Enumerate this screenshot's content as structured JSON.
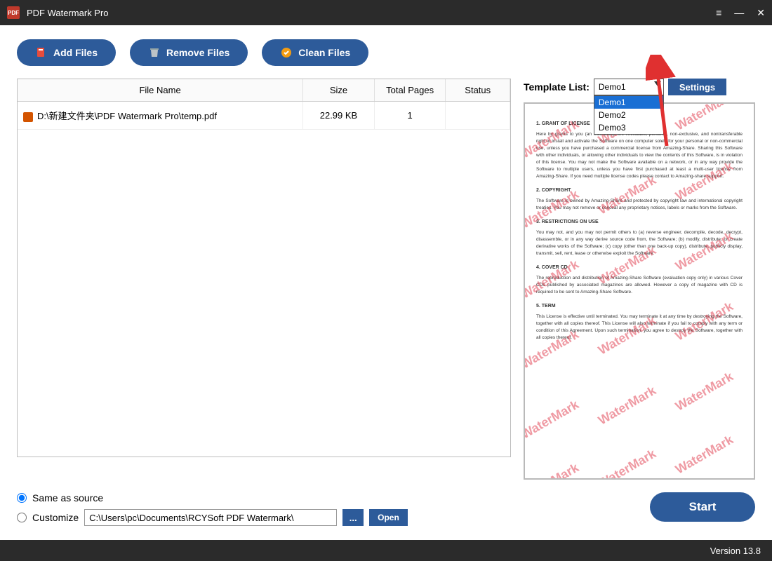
{
  "app": {
    "title": "PDF Watermark Pro"
  },
  "toolbar": {
    "add_files": "Add Files",
    "remove_files": "Remove Files",
    "clean_files": "Clean Files"
  },
  "table": {
    "columns": {
      "name": "File Name",
      "size": "Size",
      "pages": "Total Pages",
      "status": "Status"
    },
    "rows": [
      {
        "name": "D:\\新建文件夹\\PDF Watermark Pro\\temp.pdf",
        "size": "22.99 KB",
        "pages": "1",
        "status": ""
      }
    ]
  },
  "template": {
    "label": "Template List:",
    "selected": "Demo1",
    "options": [
      "Demo1",
      "Demo2",
      "Demo3"
    ],
    "settings_label": "Settings"
  },
  "output": {
    "same_as_source": "Same as source",
    "customize": "Customize",
    "path": "C:\\Users\\pc\\Documents\\RCYSoft PDF Watermark\\",
    "browse": "...",
    "open": "Open"
  },
  "start_label": "Start",
  "footer": {
    "version": "Version 13.8"
  },
  "preview": {
    "watermark_text": "WaterMark",
    "sections": {
      "s1_title": "1. GRANT OF LICENSE",
      "s1_body": "Here by grants to you (an individual), the revocable, personal, non-exclusive, and nontransferable right to install and activate the Software on one computer solely for your personal or non-commercial use, unless you have purchased a commercial license from Amazing-Share. Sharing this Software with other individuals, or allowing other individuals to view the contents of this Software, is in violation of this license. You may not make the Software available on a network, or in any way provide the Software to multiple users, unless you have first purchased at least a multi-user license from Amazing-Share. If you need multiple license codes please contact to Amazing-share support.",
      "s2_title": "2. COPYRIGHT",
      "s2_body": "The Software is owned by Amazing-Share and protected by copyright law and international copyright treaties. You may not remove or conceal any proprietary notices, labels or marks from the Software.",
      "s3_title": "3. RESTRICTIONS ON USE",
      "s3_body": "You may not, and you may not permit others to (a) reverse engineer, decompile, decode, decrypt, disassemble, or in any way derive source code from, the Software; (b) modify, distribute, or create derivative works of the Software; (c) copy (other than one back-up copy), distribute, publicly display, transmit, sell, rent, lease or otherwise exploit the Software.",
      "s4_title": "4. COVER CD",
      "s4_body": "The reproduction and distribution of Amazing-Share Software (evaluation copy only) in various Cover CDs published by associated magazines are allowed. However a copy of magazine with CD is required to be sent to Amazing-Share Software.",
      "s5_title": "5. TERM",
      "s5_body": "This License is effective until terminated. You may terminate it at any time by destroying the Software, together with all copies thereof. This License will also terminate if you fail to comply with any term or condition of this Agreement. Upon such termination, you agree to destroy the Software, together with all copies thereof."
    }
  }
}
